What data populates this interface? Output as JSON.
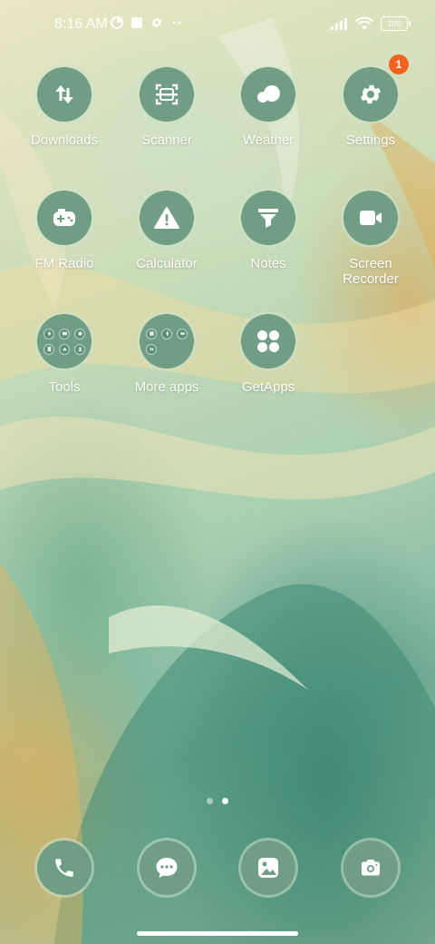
{
  "status_bar": {
    "time": "8:16 AM",
    "battery": "100",
    "left_icons": [
      "pie-icon",
      "square-icon",
      "gear-icon",
      "dots-icon"
    ],
    "right_icons": [
      "signal-icon",
      "wifi-icon",
      "battery-icon"
    ]
  },
  "apps": [
    {
      "label": "Downloads",
      "icon": "download-icon"
    },
    {
      "label": "Scanner",
      "icon": "scanner-icon"
    },
    {
      "label": "Weather",
      "icon": "cloud-icon"
    },
    {
      "label": "Settings",
      "icon": "gear-icon",
      "badge": "1"
    },
    {
      "label": "FM Radio",
      "icon": "radio-icon"
    },
    {
      "label": "Calculator",
      "icon": "warning-icon"
    },
    {
      "label": "Notes",
      "icon": "funnel-icon"
    },
    {
      "label": "Screen\nRecorder",
      "icon": "video-camera-icon"
    },
    {
      "label": "Tools",
      "icon": "folder-icon"
    },
    {
      "label": "More apps",
      "icon": "folder-icon"
    },
    {
      "label": "GetApps",
      "icon": "four-dots-icon"
    }
  ],
  "dock": [
    {
      "icon": "phone-icon"
    },
    {
      "icon": "message-icon"
    },
    {
      "icon": "gallery-icon"
    },
    {
      "icon": "camera-icon"
    }
  ],
  "page_indicator": {
    "pages": 2,
    "current": 2
  },
  "colors": {
    "icon_bg": "#6f9e84",
    "badge": "#f2621f",
    "text": "#ffffff"
  }
}
